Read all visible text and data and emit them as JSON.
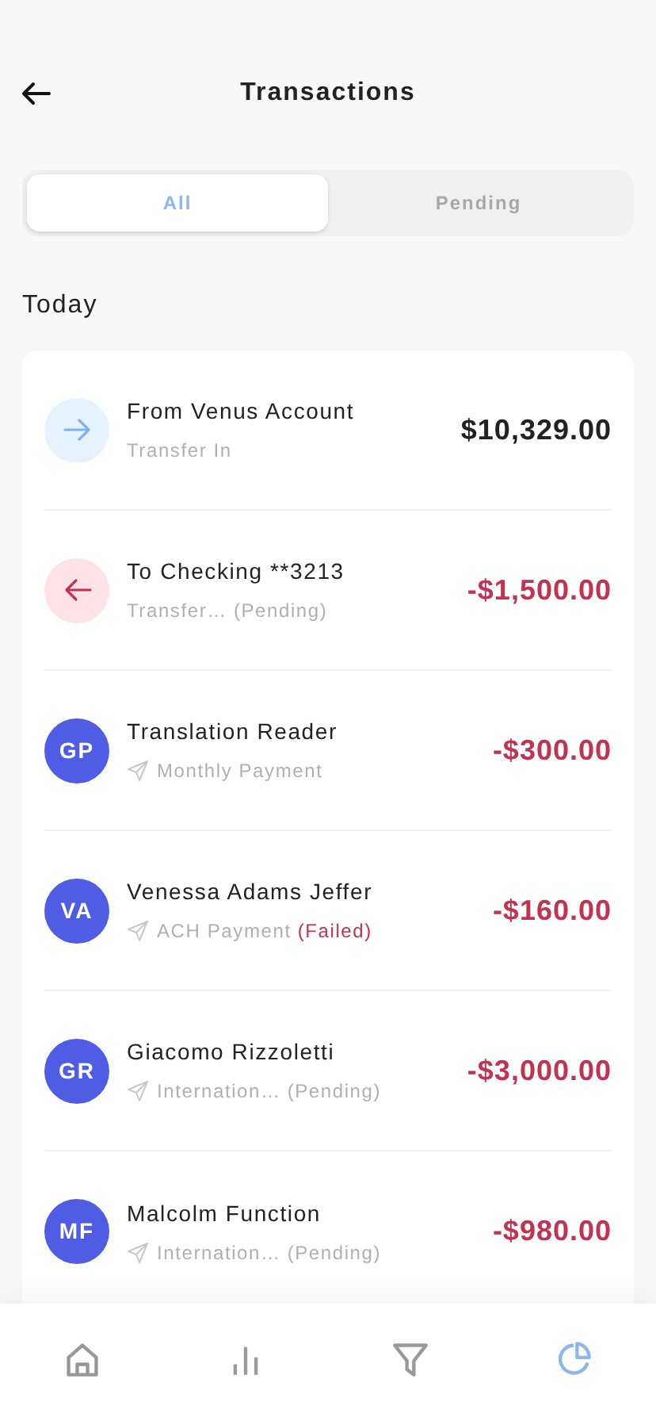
{
  "header": {
    "title": "Transactions"
  },
  "tabs": [
    {
      "label": "All",
      "selected": true
    },
    {
      "label": "Pending",
      "selected": false
    }
  ],
  "section": {
    "title": "Today"
  },
  "transactions": [
    {
      "kind": "incoming",
      "name": "From Venus Account",
      "detail": "Transfer In",
      "amount": "$10,329.00"
    },
    {
      "kind": "outgoing",
      "name": "To Checking **3213",
      "detail": "Transfer…",
      "status": {
        "kind": "pending",
        "label": "(Pending)"
      },
      "amount": "-$1,500.00"
    },
    {
      "kind": "payee",
      "initials": "GP",
      "name": "Translation Reader",
      "detail": "Monthly Payment",
      "amount": "-$300.00"
    },
    {
      "kind": "payee",
      "initials": "VA",
      "name": "Venessa Adams Jeffer",
      "detail": "ACH Payment",
      "status": {
        "kind": "failed",
        "label": "(Failed)"
      },
      "amount": "-$160.00"
    },
    {
      "kind": "payee",
      "initials": "GR",
      "name": "Giacomo Rizzoletti",
      "detail": "Internation…",
      "status": {
        "kind": "pending",
        "label": "(Pending)"
      },
      "amount": "-$3,000.00"
    },
    {
      "kind": "payee",
      "initials": "MF",
      "name": "Malcolm Function",
      "detail": "Internation…",
      "status": {
        "kind": "pending",
        "label": "(Pending)"
      },
      "amount": "-$980.00"
    }
  ],
  "nav": [
    {
      "kind": "home",
      "selected": false
    },
    {
      "kind": "stats",
      "selected": false
    },
    {
      "kind": "filter",
      "selected": false
    },
    {
      "kind": "chart",
      "selected": true
    }
  ]
}
